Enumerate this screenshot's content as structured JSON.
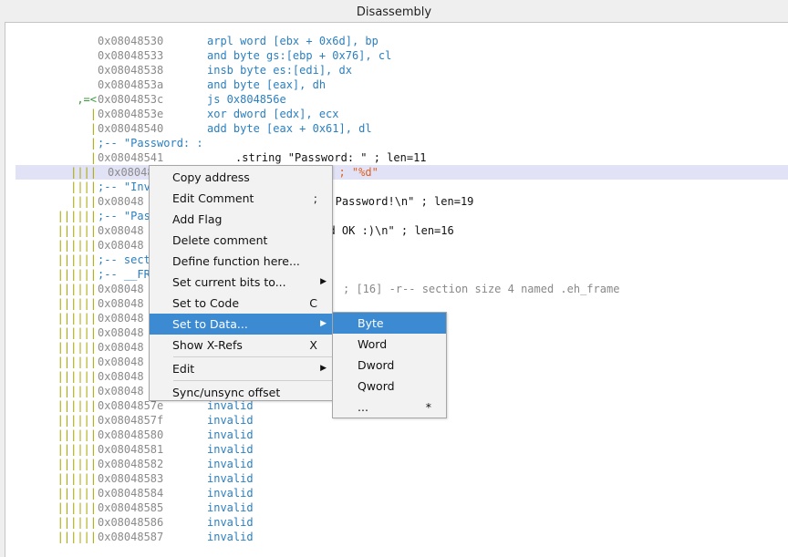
{
  "window": {
    "title": "Disassembly"
  },
  "lines": [
    {
      "gutter": "",
      "addr": "0x08048530",
      "op": "arpl word [ebx + 0x6d], bp"
    },
    {
      "gutter": "",
      "addr": "0x08048533",
      "op": "and byte gs:[ebp + 0x76], cl"
    },
    {
      "gutter": "",
      "addr": "0x08048538",
      "op": "insb byte es:[edi], dx"
    },
    {
      "gutter": "",
      "addr": "0x0804853a",
      "op": "and byte [eax], dh"
    },
    {
      "gutter": ",=<",
      "addr": "0x0804853c",
      "op": "js 0x804856e"
    },
    {
      "gutter": "|",
      "addr": "0x0804853e",
      "op": "xor dword [edx], ecx"
    },
    {
      "gutter": "|",
      "addr": "0x08048540",
      "op": "add byte [eax + 0x61], dl"
    },
    {
      "gutter": "|",
      "addr": ";-- \"Password: :",
      "op": ""
    },
    {
      "gutter": "|",
      "addr": "0x08048541",
      "op": ".string \"Password: \" ; len=11"
    },
    {
      "gutter": "||||",
      "addr": "0x08048",
      "op": "4 ; \"%d\""
    },
    {
      "gutter": "||||",
      "addr": ";-- \"Inv",
      "op": ""
    },
    {
      "gutter": "||||",
      "addr": "0x08048",
      "op": "id Password!\\n\" ; len=19"
    },
    {
      "gutter": "||||||",
      "addr": ";-- \"Pas",
      "op": ""
    },
    {
      "gutter": "||||||",
      "addr": "0x08048",
      "op": "ord OK :)\\n\" ; len=16"
    },
    {
      "gutter": "||||||",
      "addr": "0x08048",
      "op": ""
    },
    {
      "gutter": "||||||",
      "addr": ";-- sect",
      "op": ""
    },
    {
      "gutter": "||||||",
      "addr": ";-- __FR",
      "op": ""
    },
    {
      "gutter": "||||||",
      "addr": "0x08048",
      "op": "; [16] -r-- section size 4 named .eh_frame"
    },
    {
      "gutter": "||||||",
      "addr": "0x08048",
      "op": ""
    },
    {
      "gutter": "||||||",
      "addr": "0x08048",
      "op": ""
    },
    {
      "gutter": "||||||",
      "addr": "0x08048",
      "op": ""
    },
    {
      "gutter": "||||||",
      "addr": "0x08048",
      "op": ""
    },
    {
      "gutter": "||||||",
      "addr": "0x08048",
      "op": ""
    },
    {
      "gutter": "||||||",
      "addr": "0x08048",
      "op": ""
    },
    {
      "gutter": "||||||",
      "addr": "0x08048",
      "op": ""
    },
    {
      "gutter": "||||||",
      "addr": "0x0804857e",
      "op": "invalid"
    },
    {
      "gutter": "||||||",
      "addr": "0x0804857f",
      "op": "invalid"
    },
    {
      "gutter": "||||||",
      "addr": "0x08048580",
      "op": "invalid"
    },
    {
      "gutter": "||||||",
      "addr": "0x08048581",
      "op": "invalid"
    },
    {
      "gutter": "||||||",
      "addr": "0x08048582",
      "op": "invalid"
    },
    {
      "gutter": "||||||",
      "addr": "0x08048583",
      "op": "invalid"
    },
    {
      "gutter": "||||||",
      "addr": "0x08048584",
      "op": "invalid"
    },
    {
      "gutter": "||||||",
      "addr": "0x08048585",
      "op": "invalid"
    },
    {
      "gutter": "||||||",
      "addr": "0x08048586",
      "op": "invalid"
    },
    {
      "gutter": "||||||",
      "addr": "0x08048587",
      "op": "invalid"
    }
  ],
  "context_menu": {
    "copy_address": "Copy address",
    "edit_comment": "Edit Comment",
    "edit_comment_shortcut": ";",
    "add_flag": "Add Flag",
    "delete_comment": "Delete comment",
    "define_function": "Define function here...",
    "set_bits": "Set current bits to...",
    "set_to_code": "Set to Code",
    "set_to_code_shortcut": "C",
    "set_to_data": "Set to Data...",
    "show_xrefs": "Show X-Refs",
    "show_xrefs_shortcut": "X",
    "edit": "Edit",
    "sync_offset": "Sync/unsync offset"
  },
  "submenu": {
    "byte": "Byte",
    "word": "Word",
    "dword": "Dword",
    "qword": "Qword",
    "more": "...",
    "more_shortcut": "*"
  },
  "colors": {
    "accent": "#3b8ad2",
    "highlight": "#e2e2f6",
    "opcode": "#2a7fc0",
    "number": "#e06020",
    "gutter": "#a8a800",
    "jump": "#3b9a3b"
  }
}
